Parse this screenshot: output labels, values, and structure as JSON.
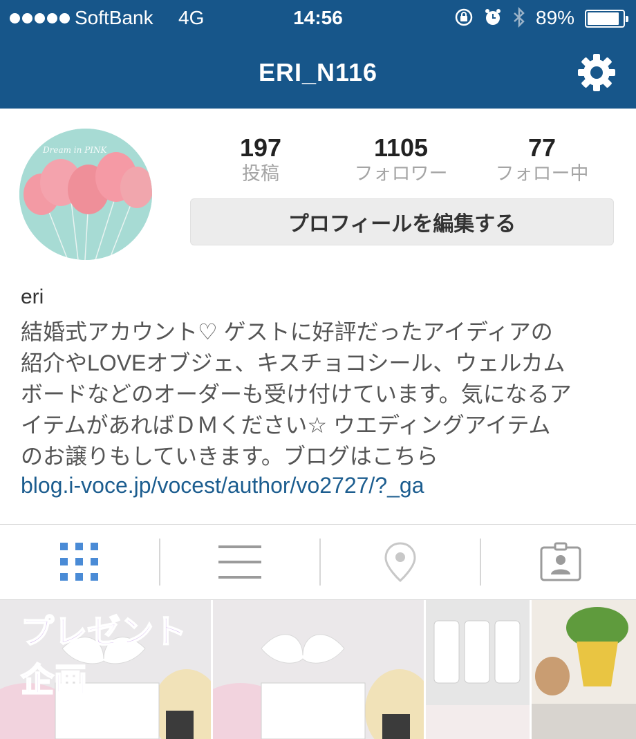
{
  "status_bar": {
    "carrier": "SoftBank",
    "network": "4G",
    "time": "14:56",
    "battery_percent": "89%",
    "battery_level": 0.89
  },
  "header": {
    "username": "ERI_N116",
    "settings_icon": "gear-icon",
    "background_color": "#17568a"
  },
  "profile": {
    "avatar_text": "Dream in PINK",
    "stats": {
      "posts": {
        "count": "197",
        "label": "投稿"
      },
      "followers": {
        "count": "1105",
        "label": "フォロワー"
      },
      "following": {
        "count": "77",
        "label": "フォロー中"
      }
    },
    "edit_button_label": "プロフィールを編集する",
    "display_name": "eri",
    "bio": "結婚式アカウント♡ ゲストに好評だったアイディアの\n紹介やLOVEオブジェ、キスチョコシール、ウェルカム\nボードなどのオーダーも受け付けています。気になるア\nイテムがあればＤＭください☆ ウエディングアイテム\nのお譲りもしていきます。ブログはこちら",
    "link": "blog.i-voce.jp/vocest/author/vo2727/?_ga",
    "link_color": "#1c5d8f"
  },
  "tabs": [
    {
      "name": "grid-view",
      "icon": "grid-icon",
      "active": true
    },
    {
      "name": "list-view",
      "icon": "list-icon",
      "active": false
    },
    {
      "name": "map-view",
      "icon": "location-pin-icon",
      "active": false
    },
    {
      "name": "tagged-view",
      "icon": "tagged-person-icon",
      "active": false
    }
  ],
  "grid": {
    "first_caption": "プレゼント企画"
  }
}
